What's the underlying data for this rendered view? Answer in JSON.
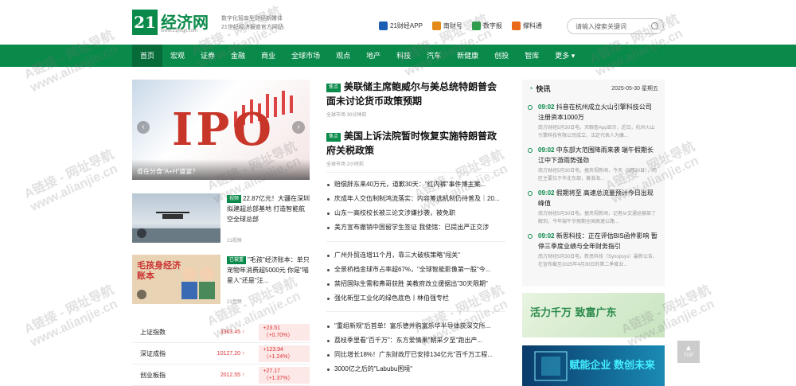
{
  "header": {
    "logo_num": "21",
    "logo_text": "经济网",
    "logo_url": "www.21jingji.com",
    "tagline_1": "数字化智库型财经新媒体",
    "tagline_2": "21世纪经济报道官方网站",
    "apps": [
      {
        "label": "21财经APP",
        "color": "#1a5fb4"
      },
      {
        "label": "南财号",
        "color": "#e48a1a"
      },
      {
        "label": "数字报",
        "color": "#2aa04a"
      },
      {
        "label": "撑科通",
        "color": "#e86a1a"
      }
    ],
    "search_placeholder": "请输入搜索关键词"
  },
  "nav": [
    "首页",
    "宏观",
    "证券",
    "金融",
    "商业",
    "全球市场",
    "观点",
    "地产",
    "科技",
    "汽车",
    "新健康",
    "创投",
    "智库",
    "更多"
  ],
  "hero": {
    "caption": "谁在分食\"A+H\"盛宴？",
    "big_text": "IPO"
  },
  "cards": [
    {
      "tag": "视频",
      "title": "22.87亿元！大疆在深圳拟建超总部基地 打造智能航空全球总部",
      "meta": "21视频"
    },
    {
      "tag": "已被重",
      "title": "\"毛孩\"经济账本：单只宠物年消费超5000元 你是\"喵星人\"还是\"汪...",
      "meta": "21音频"
    }
  ],
  "thumb2_text": "毛孩身经济账本",
  "indices": [
    {
      "name": "上证指数",
      "value": "3363.45",
      "change": "+23.51（+0.70%）"
    },
    {
      "name": "深证成指",
      "value": "10127.20",
      "change": "+123.94（+1.24%）"
    },
    {
      "name": "创业板指",
      "value": "2012.55",
      "change": "+27.17（+1.37%）"
    }
  ],
  "headlines": [
    {
      "tag": "焦点",
      "title": "美联储主席鲍威尔与美总统特朗普会面未讨论货币政策预期",
      "meta": "全球市场 30分钟前"
    },
    {
      "tag": "焦点",
      "title": "美国上诉法院暂时恢复实施特朗普政府关税政策",
      "meta": "全球市场 2小时前"
    }
  ],
  "list1": [
    "赔偿胖东来40万元，道歉30天：\"红内裤\"事件博主案...",
    "庆成年人交伍制制鸿流落实：内容筹选机制仍待普及｜20...",
    "山东一高校校长被三论文涉嫌抄袭，被免职",
    "美方宣布撤销中国留学生签证 我使馆：已提出严正交涉"
  ],
  "list2": [
    "广州外贸连增11个月，靠三大破核策略\"闯关\"",
    "全景桥档金球市占率超67%，\"全球智能影像第一股\"今...",
    "禁招国际生需和弗哥获胜 美教府改立援据出\"30天限期\"",
    "强化新型工业化的绿色底色丨林伯强专栏"
  ],
  "list3": [
    "\"重组新规\"后首单！富乐德并购富乐华半导体获深交所...",
    "荔枝季里看\"百千万\"：东方爱情果\"朝采夕至\"跑出产...",
    "同比增长18%！广东财政厅已安排134亿元\"百千万工程...",
    "3000亿之后的\"Labubu困境\""
  ],
  "flash": {
    "title": "快讯",
    "date": "2025-05-30 星期五",
    "items": [
      {
        "time": "09:02",
        "text": "抖音在杭州成立火山引擎科技公司 注册资本1000万",
        "desc": "南方财经5月30日电，天眼查App显示，近日，杭州火山引擎科技有限公司成立，法定代表人为康..."
      },
      {
        "time": "09:02",
        "text": "中东部大范围降雨来袭 端午假期长江中下游雨势强劲",
        "desc": "南方财经5月30日电，据央视新闻，今天（5月30日），雨区主要位于华北东部，黄淮海..."
      },
      {
        "time": "09:02",
        "text": "假期将至 高速总流量预计今日出现峰值",
        "desc": "南方财经5月30日电，据央视新闻，记者从交通运输部了解到，今年端午节假期全国高速公路..."
      },
      {
        "time": "09:02",
        "text": "新思科技：正在评估BIS函件影响 暂停三季度业绩与全年财务指引",
        "desc": "南方财经5月30日电，新思科技（Synopsys）最新公告，在宣布截至2025年4月30日的第二季度业..."
      }
    ]
  },
  "ad1_text": "活力千万 致富广东",
  "ad2_text": "赋能企业 数创未来",
  "top_label": "TOP",
  "watermark_a": "A链接 - 网址导航",
  "watermark_b": "www.alianjie.cn"
}
